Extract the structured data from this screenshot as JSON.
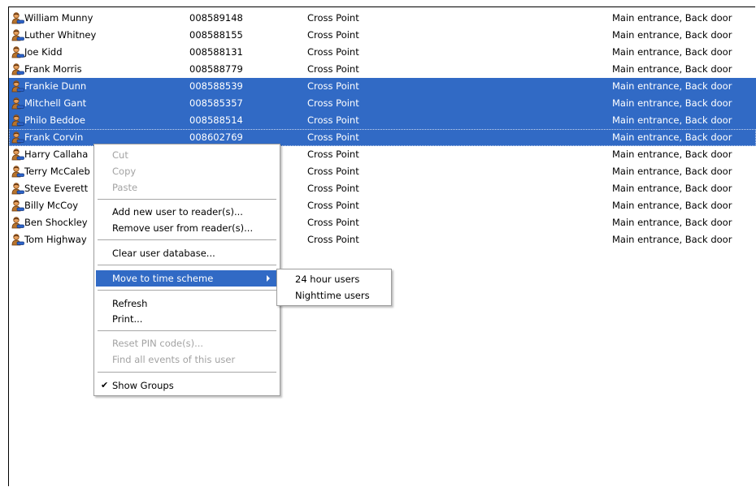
{
  "users": [
    {
      "name": "William Munny",
      "id": "008589148",
      "type": "Cross Point",
      "readers": "Main entrance, Back door",
      "selected": false
    },
    {
      "name": "Luther Whitney",
      "id": "008588155",
      "type": "Cross Point",
      "readers": "Main entrance, Back door",
      "selected": false
    },
    {
      "name": "Joe Kidd",
      "id": "008588131",
      "type": "Cross Point",
      "readers": "Main entrance, Back door",
      "selected": false
    },
    {
      "name": "Frank Morris",
      "id": "008588779",
      "type": "Cross Point",
      "readers": "Main entrance, Back door",
      "selected": false
    },
    {
      "name": "Frankie Dunn",
      "id": "008588539",
      "type": "Cross Point",
      "readers": "Main entrance, Back door",
      "selected": true
    },
    {
      "name": "Mitchell Gant",
      "id": "008585357",
      "type": "Cross Point",
      "readers": "Main entrance, Back door",
      "selected": true
    },
    {
      "name": "Philo Beddoe",
      "id": "008588514",
      "type": "Cross Point",
      "readers": "Main entrance, Back door",
      "selected": true
    },
    {
      "name": "Frank Corvin",
      "id": "008602769",
      "type": "Cross Point",
      "readers": "Main entrance, Back door",
      "selected": true,
      "focused": true
    },
    {
      "name": "Harry Callaha",
      "id": "",
      "type": "Cross Point",
      "readers": "Main entrance, Back door",
      "selected": false
    },
    {
      "name": "Terry McCaleb",
      "id": "",
      "type": "Cross Point",
      "readers": "Main entrance, Back door",
      "selected": false
    },
    {
      "name": "Steve Everett",
      "id": "",
      "type": "Cross Point",
      "readers": "Main entrance, Back door",
      "selected": false
    },
    {
      "name": "Billy McCoy",
      "id": "",
      "type": "Cross Point",
      "readers": "Main entrance, Back door",
      "selected": false
    },
    {
      "name": "Ben Shockley",
      "id": "",
      "type": "Cross Point",
      "readers": "Main entrance, Back door",
      "selected": false
    },
    {
      "name": "Tom Highway",
      "id": "",
      "type": "Cross Point",
      "readers": "Main entrance, Back door",
      "selected": false
    }
  ],
  "context_menu": {
    "cut": "Cut",
    "copy": "Copy",
    "paste": "Paste",
    "add_user": "Add new user to reader(s)...",
    "remove_user": "Remove user from reader(s)...",
    "clear_db": "Clear user database...",
    "move_time_scheme": "Move to time scheme",
    "refresh": "Refresh",
    "print": "Print...",
    "reset_pin": "Reset PIN code(s)...",
    "find_events": "Find all events of this user",
    "show_groups": "Show Groups"
  },
  "submenu": {
    "item_24h": "24 hour users",
    "item_night": "Nighttime users"
  },
  "icons": {
    "user": "user-icon",
    "check": "✔",
    "submenu_arrow": "chevron-right-icon"
  },
  "colors": {
    "selection": "#316ac5",
    "disabled_text": "#a3a3a3"
  }
}
